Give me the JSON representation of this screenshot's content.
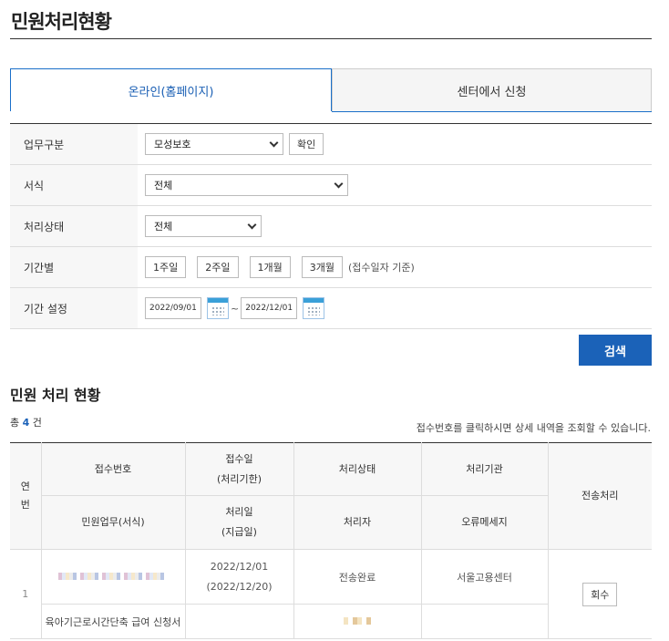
{
  "page": {
    "title": "민원처리현황"
  },
  "tabs": [
    {
      "label": "온라인(홈페이지)",
      "active": true
    },
    {
      "label": "센터에서 신청",
      "active": false
    }
  ],
  "form": {
    "business_type": {
      "label": "업무구분",
      "value": "모성보호",
      "confirm": "확인"
    },
    "form_type": {
      "label": "서식",
      "value": "전체"
    },
    "status": {
      "label": "처리상태",
      "value": "전체"
    },
    "period": {
      "label": "기간별",
      "buttons": [
        "1주일",
        "2주일",
        "1개월",
        "3개월"
      ],
      "hint": "(접수일자 기준)"
    },
    "range": {
      "label": "기간 설정",
      "from": "2022/09/01",
      "to": "2022/12/01",
      "sep": "~"
    }
  },
  "search_label": "검색",
  "results": {
    "title": "민원 처리 현황",
    "total_prefix": "총",
    "total_count": "4",
    "total_suffix": "건",
    "notice": "접수번호를 클릭하시면 상세 내역을 조회할 수 있습니다.",
    "headers": {
      "no": "연\n번",
      "receipt_no": "접수번호",
      "receipt_date": "접수일\n(처리기한)",
      "status": "처리상태",
      "agency": "처리기관",
      "transfer": "전송처리",
      "service": "민원업무(서식)",
      "processed_date": "처리일\n(지급일)",
      "handler": "처리자",
      "error": "오류메세지"
    },
    "rows": [
      {
        "no": "1",
        "receipt_date": "2022/12/01",
        "deadline": "(2022/12/20)",
        "status": "전송완료",
        "agency": "서울고용센터",
        "action": "회수",
        "service": "육아기근로시간단축 급여 신청서"
      }
    ]
  }
}
